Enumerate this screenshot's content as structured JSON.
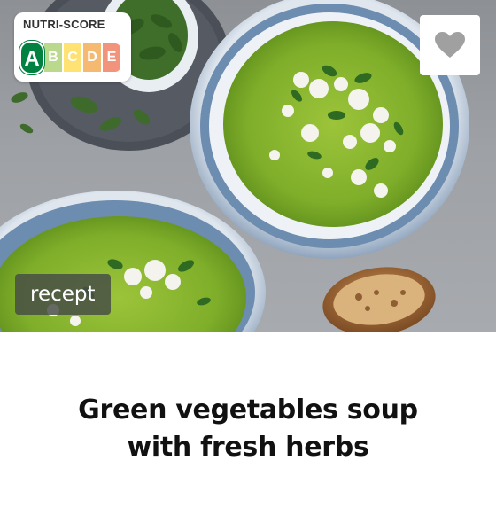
{
  "nutri_score": {
    "title": "NUTRI-SCORE",
    "selected": "A",
    "grades": [
      "A",
      "B",
      "C",
      "D",
      "E"
    ],
    "colors": {
      "A": "#038141",
      "B": "#85bb2f",
      "C": "#fecb02",
      "D": "#ee8100",
      "E": "#e63e11"
    }
  },
  "favorite": {
    "icon": "heart-icon",
    "color": "#a0a0a0"
  },
  "category_tag": "recept",
  "recipe": {
    "title_line1": "Green vegetables soup",
    "title_line2": "with fresh herbs"
  }
}
